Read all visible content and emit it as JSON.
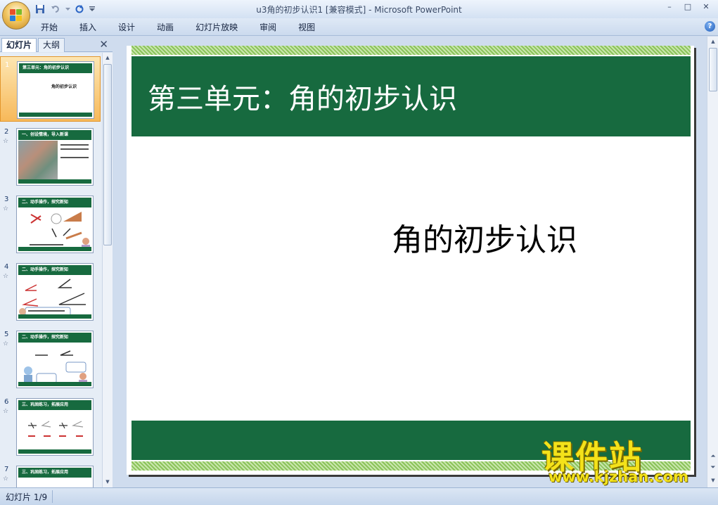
{
  "window": {
    "title": "u3角的初步认识1 [兼容模式] - Microsoft PowerPoint",
    "minimize": "–",
    "maximize": "□",
    "close": "✕"
  },
  "ribbon": {
    "tabs": [
      {
        "label": "开始"
      },
      {
        "label": "插入"
      },
      {
        "label": "设计"
      },
      {
        "label": "动画"
      },
      {
        "label": "幻灯片放映"
      },
      {
        "label": "审阅"
      },
      {
        "label": "视图"
      }
    ],
    "help": "?"
  },
  "pane": {
    "tabs": [
      {
        "label": "幻灯片"
      },
      {
        "label": "大纲"
      }
    ],
    "close": "✕",
    "thumbnails": [
      {
        "num": "1",
        "bar": "第三单元：角的初步认识",
        "caption": "角的初步认识",
        "selected": true
      },
      {
        "num": "2",
        "bar": "一、创设情境，导入新课",
        "selected": false
      },
      {
        "num": "3",
        "bar": "二、动手操作，探究新知",
        "selected": false
      },
      {
        "num": "4",
        "bar": "二、动手操作，探究新知",
        "selected": false
      },
      {
        "num": "5",
        "bar": "二、动手操作，探究新知",
        "selected": false
      },
      {
        "num": "6",
        "bar": "三、巩固练习，拓展应用",
        "selected": false
      },
      {
        "num": "7",
        "bar": "三、巩固练习，拓展应用",
        "selected": false
      }
    ],
    "star": "☆"
  },
  "slide": {
    "title": "第三单元：角的初步认识",
    "subtitle": "角的初步认识"
  },
  "watermark": {
    "text": "课件站",
    "url": "www.kjzhan.com"
  },
  "status": {
    "slide_indicator": "幻灯片 1/9"
  },
  "colors": {
    "slide_green": "#176a3f",
    "stripe_green": "#8bc35a",
    "selection_orange": "#f7b95a",
    "watermark_yellow": "#f4e21a"
  }
}
